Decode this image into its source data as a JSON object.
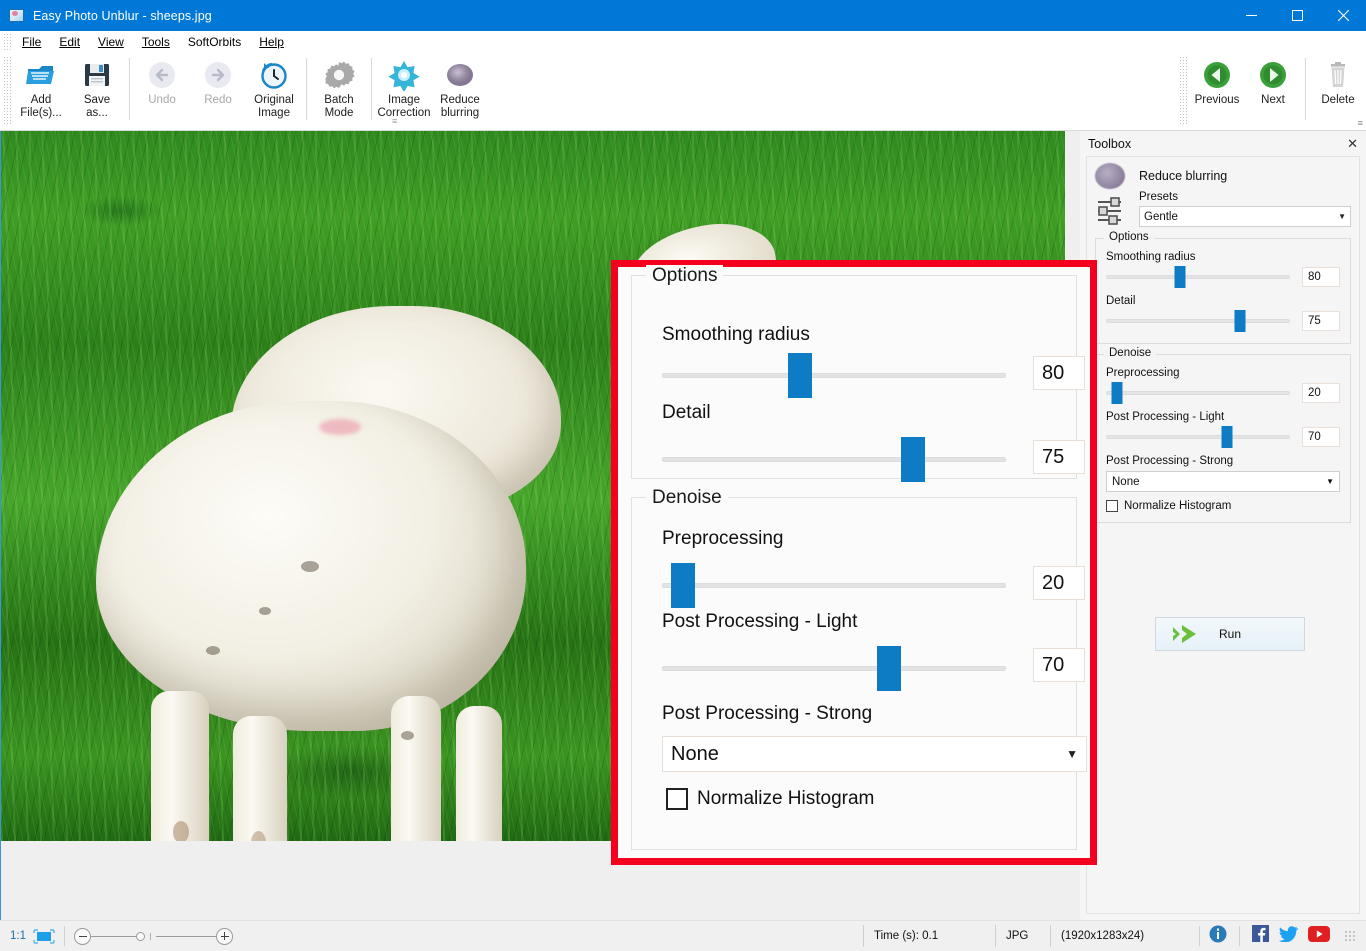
{
  "window": {
    "title": "Easy Photo Unblur - sheeps.jpg",
    "icon": "app-photo-icon",
    "minimize": "minimize-icon",
    "maximize": "maximize-icon",
    "close": "close-icon",
    "accent": "#0078d7"
  },
  "menu": {
    "items": [
      {
        "label": "File",
        "accel": "F"
      },
      {
        "label": "Edit",
        "accel": "E"
      },
      {
        "label": "View",
        "accel": "V"
      },
      {
        "label": "Tools",
        "accel": "T"
      },
      {
        "label": "SoftOrbits",
        "accel": ""
      },
      {
        "label": "Help",
        "accel": "H"
      }
    ]
  },
  "toolbar": {
    "left_buttons": [
      {
        "label": "Add\nFile(s)...",
        "icon": "add-files-icon",
        "disabled": false
      },
      {
        "label": "Save\nas...",
        "icon": "save-as-icon",
        "disabled": false
      },
      {
        "label": "Undo",
        "icon": "undo-icon",
        "disabled": true
      },
      {
        "label": "Redo",
        "icon": "redo-icon",
        "disabled": true
      },
      {
        "label": "Original\nImage",
        "icon": "original-image-icon",
        "disabled": false
      },
      {
        "label": "Batch\nMode",
        "icon": "batch-mode-icon",
        "disabled": false
      },
      {
        "label": "Image\nCorrection",
        "icon": "image-correction-icon",
        "disabled": false
      },
      {
        "label": "Reduce\nblurring",
        "icon": "reduce-blurring-icon",
        "disabled": false
      }
    ],
    "right_buttons": [
      {
        "label": "Previous",
        "icon": "previous-arrow-icon",
        "disabled": false
      },
      {
        "label": "Next",
        "icon": "next-arrow-icon",
        "disabled": false
      },
      {
        "label": "Delete",
        "icon": "trash-icon",
        "disabled": false
      }
    ]
  },
  "toolbox": {
    "header": "Toolbox",
    "close": "close-icon",
    "tool_title": "Reduce blurring",
    "presets_label": "Presets",
    "presets_value": "Gentle",
    "options": {
      "legend": "Options",
      "params": [
        {
          "label": "Smoothing radius",
          "value": "80",
          "percent": 40
        },
        {
          "label": "Detail",
          "value": "75",
          "percent": 72
        }
      ]
    },
    "denoise": {
      "legend": "Denoise",
      "params": [
        {
          "label": "Preprocessing",
          "value": "20",
          "percent": 6
        },
        {
          "label": "Post Processing - Light",
          "value": "70",
          "percent": 60
        }
      ],
      "strong_label": "Post Processing - Strong",
      "strong_value": "None",
      "checkbox_label": "Normalize Histogram",
      "checkbox_checked": false
    },
    "run_label": "Run",
    "run_icon": "green-arrow-icon"
  },
  "callout": {
    "border_color": "#f4001e",
    "options": {
      "legend": "Options",
      "params": [
        {
          "label": "Smoothing radius",
          "value": "80",
          "percent": 40
        },
        {
          "label": "Detail",
          "value": "75",
          "percent": 72
        }
      ]
    },
    "denoise": {
      "legend": "Denoise",
      "params": [
        {
          "label": "Preprocessing",
          "value": "20",
          "percent": 6
        },
        {
          "label": "Post Processing - Light",
          "value": "70",
          "percent": 60
        }
      ],
      "strong_label": "Post Processing - Strong",
      "strong_value": "None",
      "checkbox_label": "Normalize Histogram"
    }
  },
  "statusbar": {
    "ratio": "1:1",
    "fit_icon": "fit-to-window-icon",
    "zoom_out_icon": "zoom-out-icon",
    "zoom_in_icon": "zoom-in-icon",
    "time": "Time (s): 0.1",
    "format": "JPG",
    "dimensions": "(1920x1283x24)",
    "icons": [
      {
        "name": "info-icon",
        "color": "#2a7ab8"
      },
      {
        "name": "facebook-icon",
        "color": "#3b5998"
      },
      {
        "name": "twitter-icon",
        "color": "#1da1f2"
      },
      {
        "name": "youtube-icon",
        "color": "#e02020"
      }
    ]
  }
}
